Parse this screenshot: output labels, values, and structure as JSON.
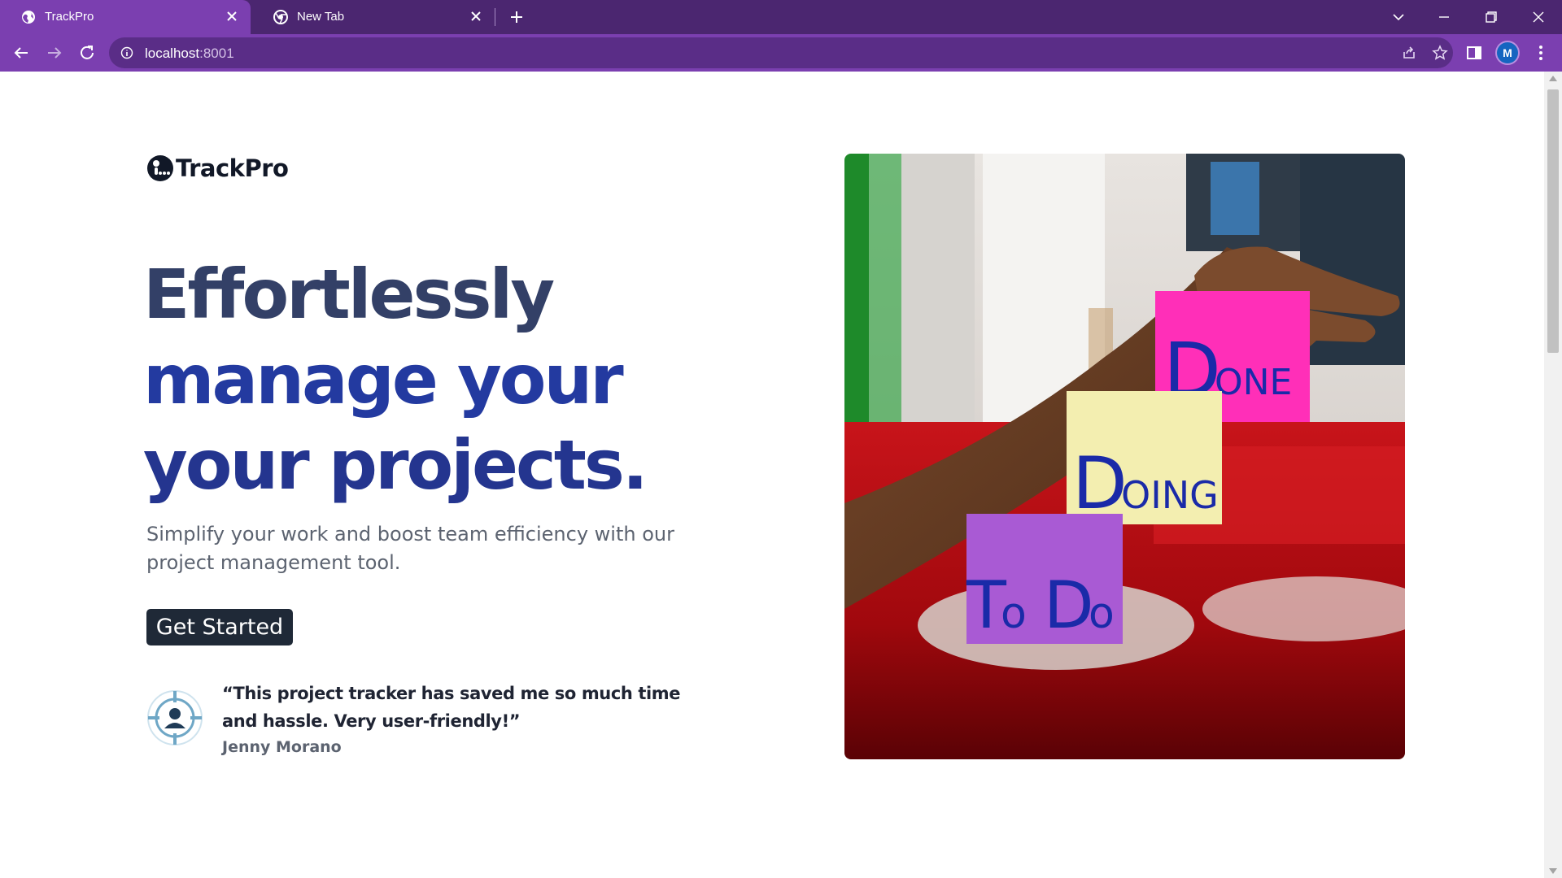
{
  "browser": {
    "tabs": [
      {
        "title": "TrackPro",
        "active": true,
        "icon": "globe-icon"
      },
      {
        "title": "New Tab",
        "active": false,
        "icon": "chrome-icon"
      }
    ],
    "address": {
      "host": "localhost",
      "port": ":8001"
    },
    "profile_initial": "M",
    "colors": {
      "frame": "#4b2670",
      "toolbar": "#7b3fb0",
      "omnibox": "#5a2d87"
    }
  },
  "page": {
    "brand": {
      "name": "TrackPro"
    },
    "hero": {
      "headline_line1": "Effortlessly",
      "headline_line2": "manage your",
      "headline_line3": "your projects.",
      "subtitle": "Simplify your work and boost team efficiency with our project management tool.",
      "cta_label": "Get Started"
    },
    "testimonial": {
      "quote": "“This project tracker has saved me so much time and hassle. Very user-friendly!”",
      "author": "Jenny Morano"
    },
    "image": {
      "notes": [
        {
          "text": "Done",
          "color": "#ff2fb8"
        },
        {
          "text": "Doing",
          "color": "#f3eeb0"
        },
        {
          "text": "To Do",
          "color": "#a95ad4"
        }
      ]
    }
  }
}
